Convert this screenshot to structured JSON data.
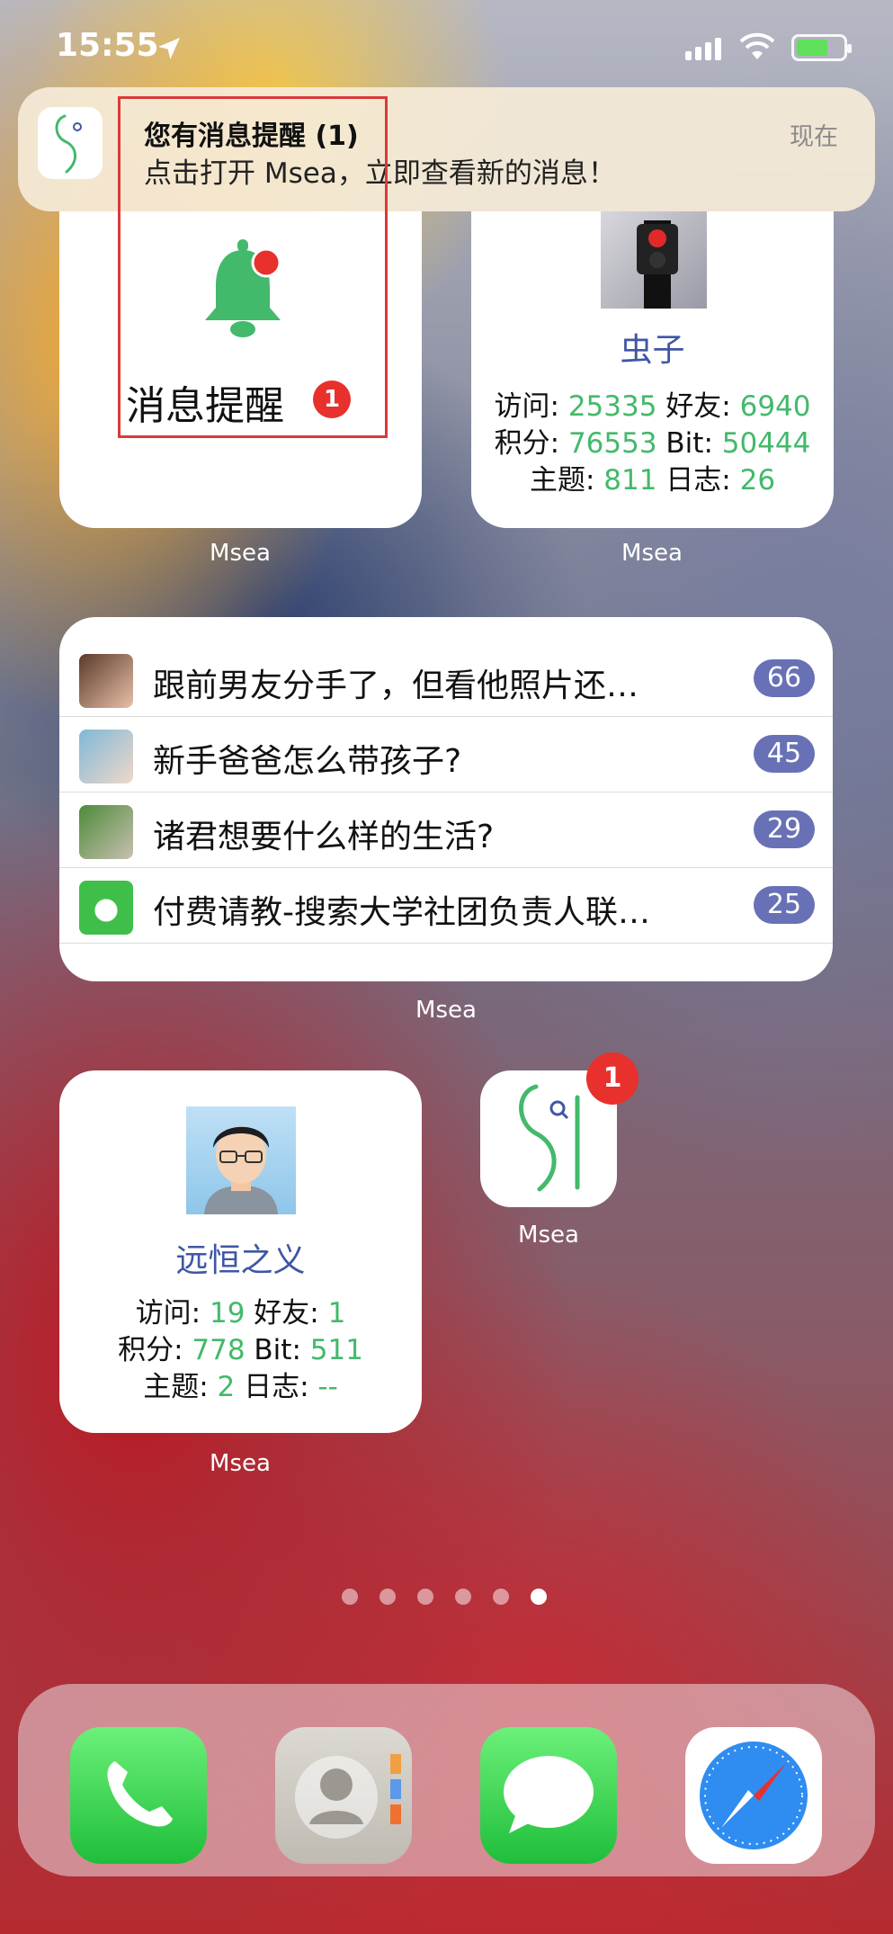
{
  "status_bar": {
    "time": "15:55"
  },
  "notification": {
    "title": "您有消息提醒 (1)",
    "body": "点击打开 Msea，立即查看新的消息！",
    "time": "现在"
  },
  "widgets": {
    "bell": {
      "label": "消息提醒",
      "badge": "1",
      "caption": "Msea"
    },
    "user1": {
      "name": "虫子",
      "visits_label": "访问: ",
      "visits": "25335",
      "friends_label": " 好友: ",
      "friends": "6940",
      "points_label": "积分: ",
      "points": "76553",
      "bit_label": " Bit: ",
      "bit": "50444",
      "topics_label": "主题: ",
      "topics": "811",
      "logs_label": " 日志: ",
      "logs": "26",
      "caption": "Msea"
    },
    "threads": {
      "caption": "Msea",
      "items": [
        {
          "title": "跟前男友分手了，但看他照片还…",
          "count": "66"
        },
        {
          "title": "新手爸爸怎么带孩子?",
          "count": "45"
        },
        {
          "title": "诸君想要什么样的生活?",
          "count": "29"
        },
        {
          "title": "付费请教-搜索大学社团负责人联…",
          "count": "25"
        }
      ]
    },
    "user2": {
      "name": "远恒之义",
      "visits_label": "访问: ",
      "visits": "19",
      "friends_label": " 好友: ",
      "friends": "1",
      "points_label": "积分: ",
      "points": "778",
      "bit_label": " Bit: ",
      "bit": "511",
      "topics_label": "主题: ",
      "topics": "2",
      "logs_label": " 日志: ",
      "logs": "--",
      "caption": "Msea"
    }
  },
  "app_icon": {
    "label": "Msea",
    "badge": "1"
  },
  "colors": {
    "accent_green": "#43b96b",
    "username_blue": "#3f56a3",
    "badge_red": "#e8302c",
    "count_pill": "#6871b5"
  }
}
